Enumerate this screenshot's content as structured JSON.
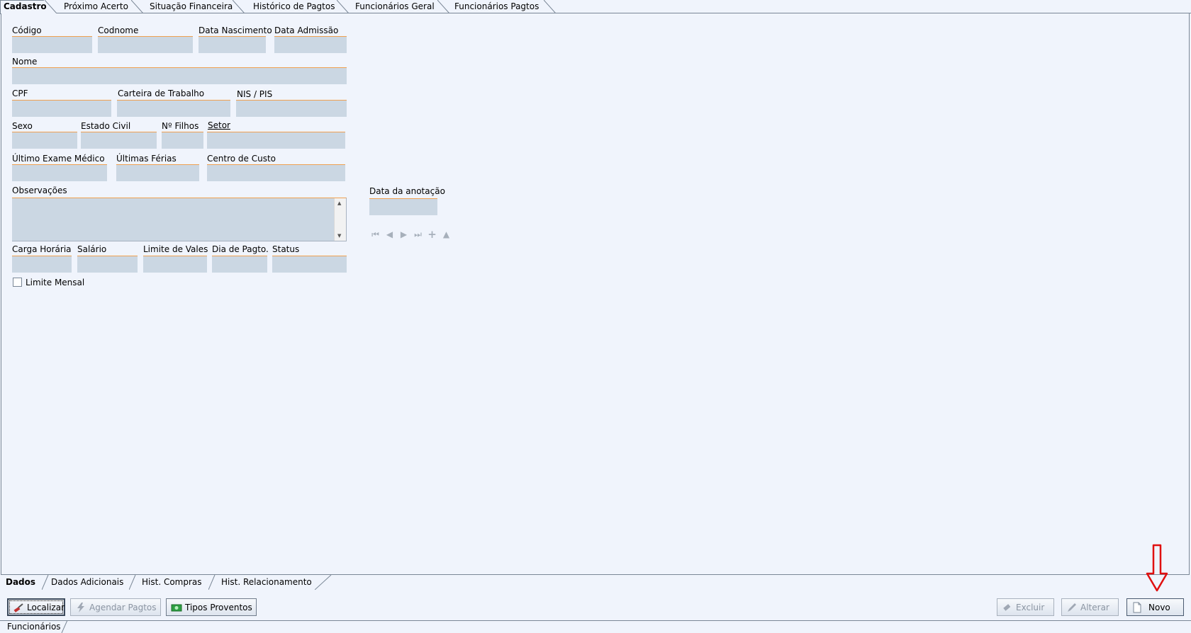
{
  "top_tabs": [
    "Cadastro",
    "Próximo Acerto",
    "Situação Financeira",
    "Histórico de Pagtos",
    "Funcionários Geral",
    "Funcionários Pagtos"
  ],
  "form": {
    "codigo": "Código",
    "codnome": "Codnome",
    "data_nascimento": "Data Nascimento",
    "data_admissao": "Data Admissão",
    "nome": "Nome",
    "cpf": "CPF",
    "carteira_trabalho": "Carteira de Trabalho",
    "nis_pis": "NIS / PIS",
    "sexo": "Sexo",
    "estado_civil": "Estado Civil",
    "n_filhos": "Nº Filhos",
    "setor": "Setor",
    "ultimo_exame": "Último Exame Médico",
    "ultimas_ferias": "Últimas Férias",
    "centro_custo": "Centro de Custo",
    "observacoes": "Observações",
    "data_anotacao": "Data da anotação",
    "carga_horaria": "Carga Horária",
    "salario": "Salário",
    "limite_vales": "Limite de Vales",
    "dia_pagto": "Dia de Pagto.",
    "status": "Status",
    "limite_mensal": "Limite Mensal"
  },
  "nav_icons": [
    "first-record-icon",
    "prior-record-icon",
    "next-record-icon",
    "last-record-icon",
    "add-record-icon",
    "up-icon"
  ],
  "sub_tabs": [
    "Dados",
    "Dados Adicionais",
    "Hist. Compras",
    "Hist. Relacionamento"
  ],
  "buttons": {
    "localizar": "Localizar",
    "agendar": "Agendar Pagtos",
    "tipos_proventos": "Tipos Proventos",
    "excluir": "Excluir",
    "alterar": "Alterar",
    "novo": "Novo"
  },
  "footer_tab": "Funcionários",
  "colors": {
    "field_bg": "#cbd7e3",
    "field_accent": "#f0a050",
    "page_bg": "#f0f4fc",
    "arrow": "#e01010"
  }
}
